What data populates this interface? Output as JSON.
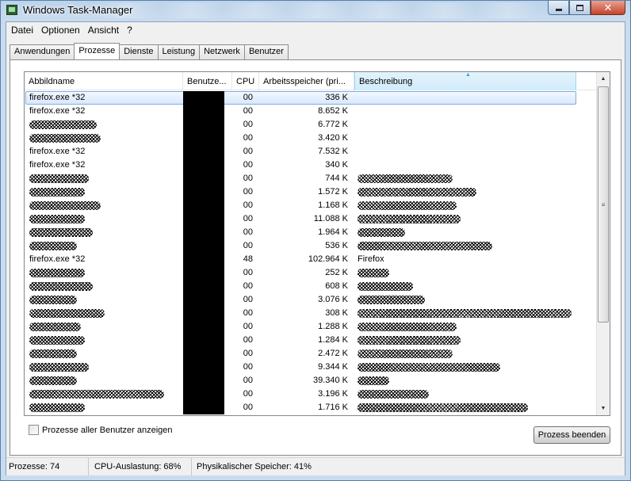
{
  "window": {
    "title": "Windows Task-Manager"
  },
  "menu": [
    "Datei",
    "Optionen",
    "Ansicht",
    "?"
  ],
  "tabs": [
    "Anwendungen",
    "Prozesse",
    "Dienste",
    "Leistung",
    "Netzwerk",
    "Benutzer"
  ],
  "active_tab": "Prozesse",
  "columns": {
    "name": "Abbildname",
    "user": "Benutze...",
    "cpu": "CPU",
    "mem": "Arbeitsspeicher (pri...",
    "desc": "Beschreibung"
  },
  "rows": [
    {
      "name": "firefox.exe *32",
      "cpu": "00",
      "mem": "336 K",
      "desc": "",
      "selected": true
    },
    {
      "name": "firefox.exe *32",
      "cpu": "00",
      "mem": "8.652 K",
      "desc": ""
    },
    {
      "name": "",
      "cpu": "00",
      "mem": "6.772 K",
      "desc": ""
    },
    {
      "name": "",
      "cpu": "00",
      "mem": "3.420 K",
      "desc": ""
    },
    {
      "name": "firefox.exe *32",
      "cpu": "00",
      "mem": "7.532 K",
      "desc": ""
    },
    {
      "name": "firefox.exe *32",
      "cpu": "00",
      "mem": "340 K",
      "desc": ""
    },
    {
      "name": "",
      "cpu": "00",
      "mem": "744 K",
      "desc": ""
    },
    {
      "name": "",
      "cpu": "00",
      "mem": "1.572 K",
      "desc": ""
    },
    {
      "name": "",
      "cpu": "00",
      "mem": "1.168 K",
      "desc": ""
    },
    {
      "name": "",
      "cpu": "00",
      "mem": "11.088 K",
      "desc": ""
    },
    {
      "name": "",
      "cpu": "00",
      "mem": "1.964 K",
      "desc": ""
    },
    {
      "name": "",
      "cpu": "00",
      "mem": "536 K",
      "desc": ""
    },
    {
      "name": "firefox.exe *32",
      "cpu": "48",
      "mem": "102.964 K",
      "desc": "Firefox"
    },
    {
      "name": "",
      "cpu": "00",
      "mem": "252 K",
      "desc": ""
    },
    {
      "name": "",
      "cpu": "00",
      "mem": "608 K",
      "desc": ""
    },
    {
      "name": "",
      "cpu": "00",
      "mem": "3.076 K",
      "desc": ""
    },
    {
      "name": "",
      "cpu": "00",
      "mem": "308 K",
      "desc": ""
    },
    {
      "name": "",
      "cpu": "00",
      "mem": "1.288 K",
      "desc": ""
    },
    {
      "name": "",
      "cpu": "00",
      "mem": "1.284 K",
      "desc": ""
    },
    {
      "name": "",
      "cpu": "00",
      "mem": "2.472 K",
      "desc": ""
    },
    {
      "name": "",
      "cpu": "00",
      "mem": "9.344 K",
      "desc": ""
    },
    {
      "name": "",
      "cpu": "00",
      "mem": "39.340 K",
      "desc": ""
    },
    {
      "name": "",
      "cpu": "00",
      "mem": "3.196 K",
      "desc": ""
    },
    {
      "name": "",
      "cpu": "00",
      "mem": "1.716 K",
      "desc": ""
    }
  ],
  "show_all_label": "Prozesse aller Benutzer anzeigen",
  "end_process_label": "Prozess beenden",
  "status": {
    "processes": "Prozesse: 74",
    "cpu": "CPU-Auslastung: 68%",
    "memory": "Physikalischer Speicher: 41%"
  }
}
